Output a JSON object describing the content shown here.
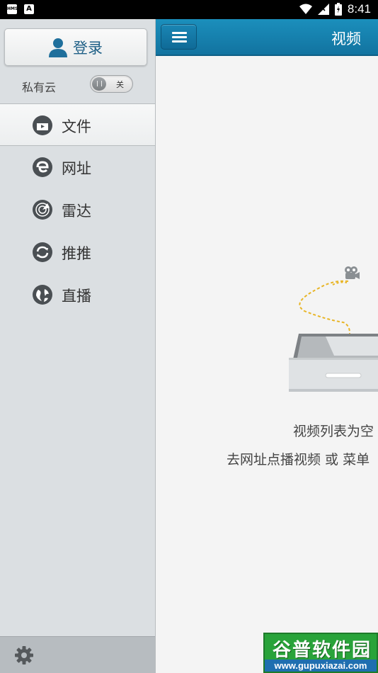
{
  "status_bar": {
    "left_icons": [
      "hms-icon",
      "a-notification-icon"
    ],
    "left_icon_text": [
      "HMS",
      "A"
    ],
    "time": "8:41"
  },
  "sidebar": {
    "login_label": "登录",
    "private_cloud_label": "私有云",
    "toggle_state_label": "关",
    "nav_items": [
      {
        "label": "文件",
        "icon": "file-video-icon",
        "active": true
      },
      {
        "label": "网址",
        "icon": "browser-e-icon",
        "active": false
      },
      {
        "label": "雷达",
        "icon": "radar-icon",
        "active": false
      },
      {
        "label": "推推",
        "icon": "push-sync-icon",
        "active": false
      },
      {
        "label": "直播",
        "icon": "globe-live-icon",
        "active": false
      }
    ],
    "footer_icon": "gear-icon"
  },
  "main": {
    "title": "视频",
    "empty_title": "视频列表为空",
    "empty_hint": "去网址点播视频 或 菜单"
  },
  "watermark": {
    "title": "谷普软件园",
    "url": "www.gupuxiazai.com"
  },
  "colors": {
    "header_blue": "#1b8fbc",
    "sidebar_bg": "#dbdfe2",
    "accent_text": "#1e5f86",
    "watermark_green": "#29a33a"
  }
}
